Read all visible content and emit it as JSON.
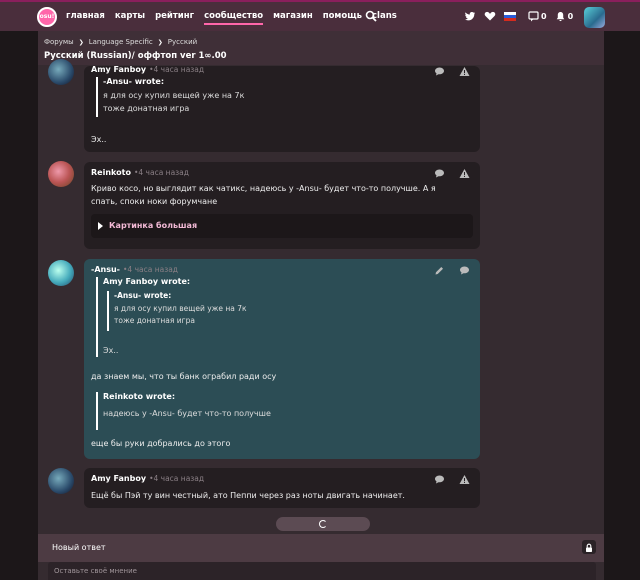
{
  "brand": {
    "logo_text": "osu!",
    "accent": "#ff66aa"
  },
  "nav": [
    "главная",
    "карты",
    "рейтинг",
    "сообщество",
    "магазин",
    "помощь",
    "clans"
  ],
  "nav_active": "сообщество",
  "header_icons": [
    "search-icon",
    "twitter-icon",
    "heart-icon",
    "flag-ru",
    "chat-icon",
    "bell-icon"
  ],
  "chat_count": "0",
  "notif_count": "0",
  "breadcrumb": [
    "Форумы",
    "Language Specific",
    "Русский"
  ],
  "forum_title": "Русский (Russian)/ оффтоп ver 1∞.00",
  "posts": [
    {
      "author": "Amy Fanboy",
      "time": "4 часа назад",
      "quote_author": "-Ansu- wrote:",
      "quote_lines": [
        "я для осу купил вещей уже на 7к",
        "тоже донатная игра"
      ],
      "text": "Эх.."
    },
    {
      "author": "Reinkoto",
      "time": "4 часа назад",
      "text_lines": [
        "Криво косо, но выглядит как чатикс, надеюсь у -Ansu- будет что-то получше. А я",
        "спать, споки ноки форумчане"
      ],
      "spoiler": "Картинка большая"
    },
    {
      "author": "-Ansu-",
      "time": "4 часа назад",
      "quote1_author": "Amy Fanboy wrote:",
      "quote1_inner_author": "-Ansu- wrote:",
      "quote1_inner_lines": [
        "я для осу купил вещей уже на 7к",
        "тоже донатная игра"
      ],
      "quote1_text": "Эх..",
      "text1": "да знаем мы, что ты банк ограбил ради осу",
      "quote2_author": "Reinkoto wrote:",
      "quote2_text": "надеюсь у -Ansu- будет что-то получше",
      "text2": "еще бы руки добрались до этого"
    },
    {
      "author": "Amy Fanboy",
      "time": "4 часа назад",
      "text": "Ещё бы Пэй ту вин честный, ато Пеппи через раз ноты двигать начинает."
    }
  ],
  "reply": {
    "title": "Новый ответ",
    "placeholder": "Оставьте своё мнение"
  }
}
